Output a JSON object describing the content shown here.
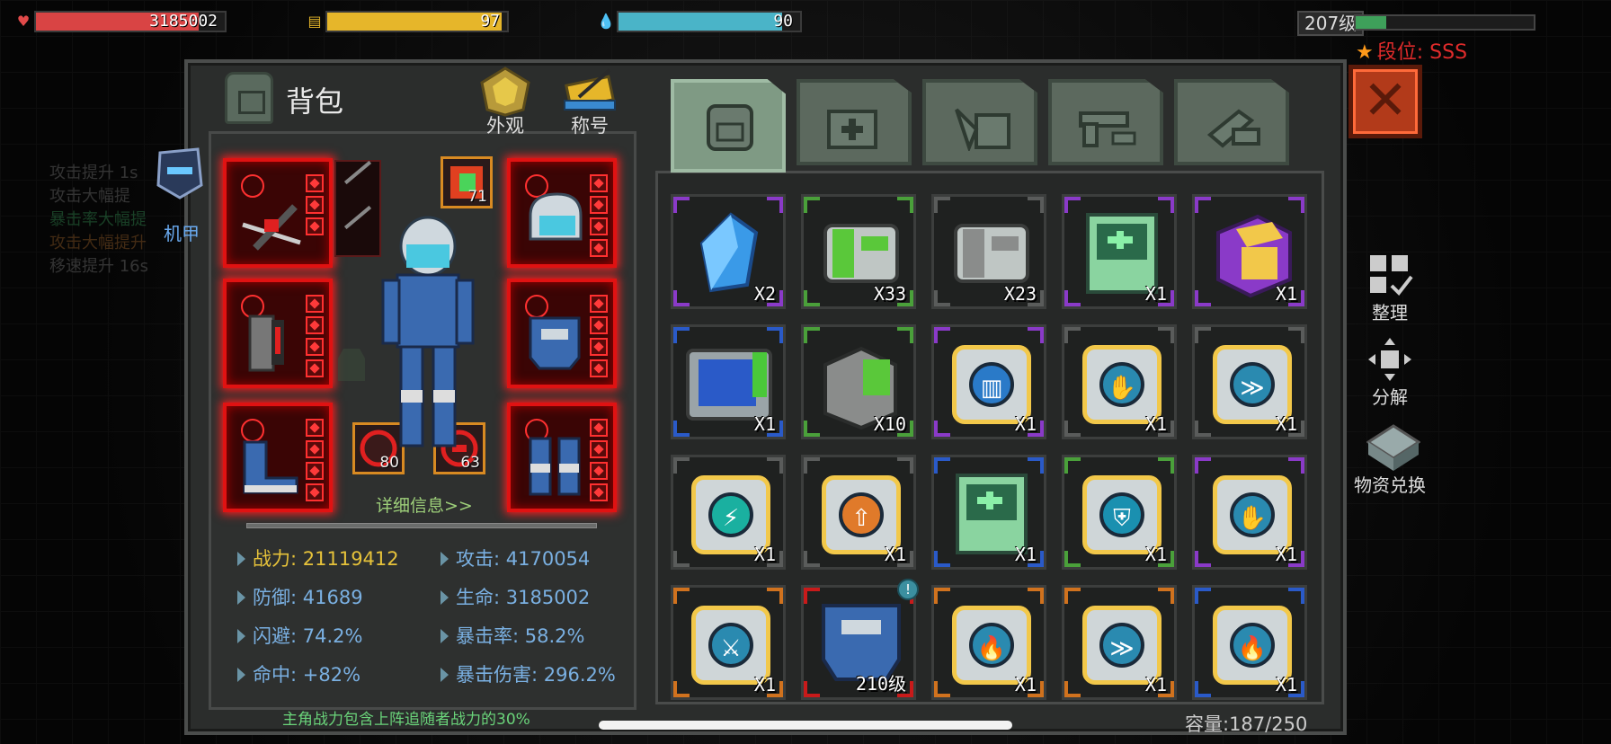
{
  "hud": {
    "hp": {
      "value": "3185002",
      "fill": 0.86,
      "color": "#d94444"
    },
    "food": {
      "value": "97",
      "fill": 0.97,
      "color": "#e6b62a"
    },
    "water": {
      "value": "90",
      "fill": 0.9,
      "color": "#4ab4c8"
    },
    "level": "207级",
    "exp_fill": 0.17,
    "rank": "段位: SSS"
  },
  "panel": {
    "title": "背包",
    "top_tabs": [
      {
        "label": "外观",
        "icon": "appearance-helmet-icon"
      },
      {
        "label": "称号",
        "icon": "title-banner-icon"
      }
    ],
    "side_label": "机甲",
    "buffs": [
      "攻击提升 1s",
      "攻击大幅提",
      "暴击率大幅提",
      "攻击大幅提升",
      "移速提升 16s"
    ],
    "detail_link": "详细信息>>",
    "mini_slots": [
      {
        "num": "71",
        "icon": "green-chip-icon"
      },
      {
        "num": "80",
        "icon": "red-gear-icon"
      },
      {
        "num": "63",
        "icon": "red-core-icon"
      }
    ],
    "stats": {
      "power": "战力: 21119412",
      "attack": "攻击: 4170054",
      "defense": "防御: 41689",
      "hp": "生命: 3185002",
      "dodge": "闪避: 74.2%",
      "crit_rate": "暴击率: 58.2%",
      "hit": "命中: +82%",
      "crit_dmg": "暴击伤害: 296.2%"
    },
    "note": "主角战力包含上阵追随者战力的30%",
    "capacity": "容量:187/250"
  },
  "category_tabs": [
    "backpack-icon",
    "medkit-icon",
    "materials-icon",
    "gun-icon",
    "wrench-icon"
  ],
  "actions": [
    {
      "label": "整理",
      "icon": "sort-grid-icon"
    },
    {
      "label": "分解",
      "icon": "decompose-icon"
    },
    {
      "label": "物资兑换",
      "icon": "exchange-icon"
    }
  ],
  "items": [
    {
      "count": "X2",
      "icon": "blue-crystal-icon",
      "rarity": "#8a3ac8"
    },
    {
      "count": "X33",
      "icon": "green-cargo-box-icon",
      "rarity": "#4aa03a"
    },
    {
      "count": "X23",
      "icon": "grey-cargo-box-icon",
      "rarity": "#5a5c5b"
    },
    {
      "count": "X1",
      "icon": "medical-terminal-icon",
      "rarity": "#8a3ac8"
    },
    {
      "count": "X1",
      "icon": "purple-gold-crate-icon",
      "rarity": "#8a3ac8"
    },
    {
      "count": "X1",
      "icon": "blue-scanner-icon",
      "rarity": "#2a5ac8"
    },
    {
      "count": "X10",
      "icon": "green-metal-crate-icon",
      "rarity": "#4aa03a"
    },
    {
      "count": "X1",
      "icon": "shield-bars-chip-icon",
      "rarity": "#8a3ac8"
    },
    {
      "count": "X1",
      "icon": "hand-chip-icon",
      "rarity": "#5a5c5b"
    },
    {
      "count": "X1",
      "icon": "speed-chip-icon",
      "rarity": "#5a5c5b"
    },
    {
      "count": "X1",
      "icon": "lightning-shield-chip-icon",
      "rarity": "#5a5c5b"
    },
    {
      "count": "X1",
      "icon": "arrow-up-chip-icon",
      "rarity": "#5a5c5b"
    },
    {
      "count": "X1",
      "icon": "medical-terminal-icon",
      "rarity": "#2a5ac8"
    },
    {
      "count": "X1",
      "icon": "shield-chip-icon",
      "rarity": "#4aa03a"
    },
    {
      "count": "X1",
      "icon": "hand-chip-icon",
      "rarity": "#8a3ac8"
    },
    {
      "count": "X1",
      "icon": "sword-chip-icon",
      "rarity": "#d0721e"
    },
    {
      "count": "210级",
      "icon": "blue-armor-chest-icon",
      "rarity": "#c81a1a",
      "badge": "!"
    },
    {
      "count": "X1",
      "icon": "fire-chip-icon",
      "rarity": "#d0721e"
    },
    {
      "count": "X1",
      "icon": "speed-chip-icon",
      "rarity": "#d0721e"
    },
    {
      "count": "X1",
      "icon": "fire-chip-icon",
      "rarity": "#2a5ac8"
    }
  ]
}
